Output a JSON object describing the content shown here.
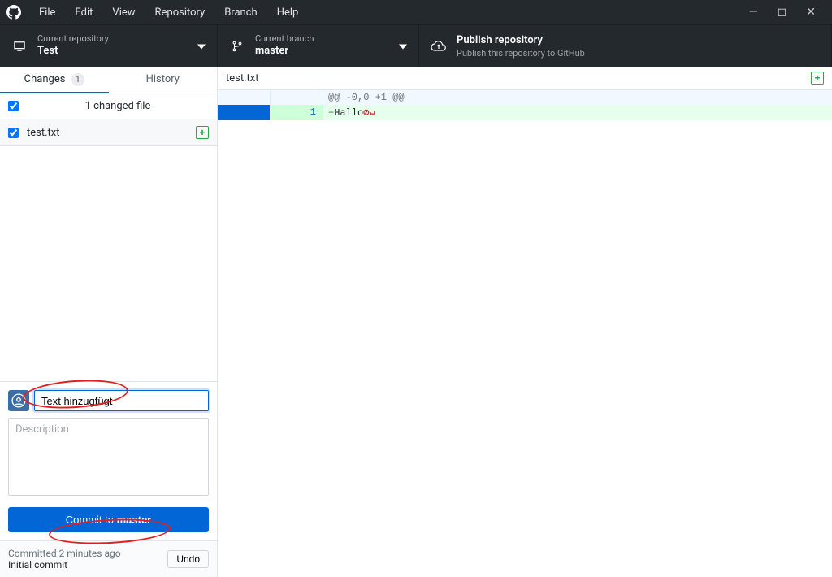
{
  "menubar": {
    "items": [
      "File",
      "Edit",
      "View",
      "Repository",
      "Branch",
      "Help"
    ]
  },
  "toolbar": {
    "repo": {
      "label": "Current repository",
      "value": "Test"
    },
    "branch": {
      "label": "Current branch",
      "value": "master"
    },
    "publish": {
      "label": "Publish repository",
      "sub": "Publish this repository to GitHub"
    }
  },
  "tabs": {
    "changes": "Changes",
    "changes_count": "1",
    "history": "History"
  },
  "changes": {
    "summary": "1 changed file",
    "file": "test.txt"
  },
  "commit": {
    "summary_value": "Text hinzugfügt",
    "description_placeholder": "Description",
    "button_prefix": "Commit to ",
    "button_branch": "master"
  },
  "lastcommit": {
    "time": "Committed 2 minutes ago",
    "message": "Initial commit",
    "undo": "Undo"
  },
  "diff": {
    "filename": "test.txt",
    "hunk": "@@ -0,0 +1 @@",
    "line_no": "1",
    "line_prefix": "+",
    "line_text": "Hallo",
    "newline_marker": "⊘↵"
  }
}
